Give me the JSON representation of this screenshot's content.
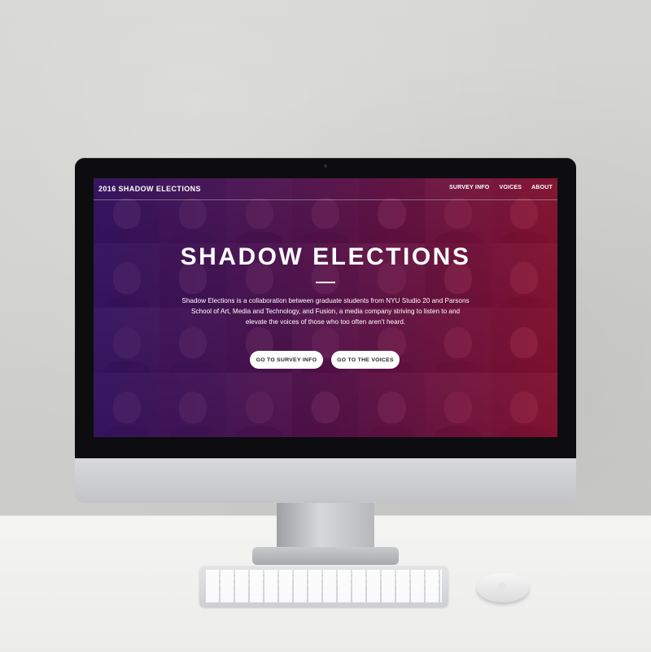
{
  "site": {
    "brand": "2016 SHADOW ELECTIONS",
    "nav": [
      "SURVEY INFO",
      "VOICES",
      "ABOUT"
    ],
    "hero_title": "SHADOW ELECTIONS",
    "description": "Shadow Elections is a collaboration between graduate students from NYU Studio 20 and Parsons School of Art, Media and Technology, and Fusion, a media company striving to listen to and elevate the voices of those who too often aren't heard.",
    "buttons": {
      "survey": "GO TO SURVEY INFO",
      "voices": "GO TO THE VOICES"
    }
  },
  "colors": {
    "overlay_left": "#46198c",
    "overlay_right": "#d7143c",
    "text": "#ffffff"
  },
  "icons": {
    "keyboard": "keyboard-icon",
    "mouse": "mouse-icon"
  }
}
